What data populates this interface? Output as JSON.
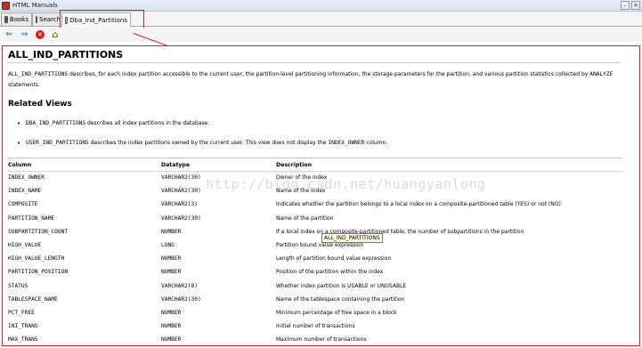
{
  "window": {
    "title": "HTML Manuals"
  },
  "tabs": [
    {
      "label": "Books"
    },
    {
      "label": "Search"
    },
    {
      "label": "Dba_Ind_Partitions"
    }
  ],
  "toolbar": {
    "back_icon": "back-arrow-icon",
    "forward_icon": "forward-arrow-icon",
    "stop_icon": "stop-icon",
    "home_icon": "home-icon"
  },
  "page": {
    "title": "ALL_IND_PARTITIONS",
    "intro": {
      "code1": "ALL_IND_PARTITIONS",
      "text": " describes, for each index partition accessible to the current user, the partition-level partitioning information, the storage parameters for the partition, and various partition statistics collected by ",
      "code2": "ANALYZE",
      "text2": " statements."
    },
    "related_heading": "Related Views",
    "related": [
      {
        "code": "DBA_IND_PARTITIONS",
        "text": " describes all index partitions in the database.",
        "code_b": "",
        "text_b": ""
      },
      {
        "code": "USER_IND_PARTITIONS",
        "text": " describes the index partitions owned by the current user. This view does not display the ",
        "code_b": "INDEX_OWNER",
        "text_b": " column."
      }
    ],
    "columns_header": {
      "col1": "Column",
      "col2": "Datatype",
      "col3": "Description"
    },
    "rows": [
      {
        "column": "INDEX_OWNER",
        "datatype": "VARCHAR2(30)",
        "desc": "Owner of the index"
      },
      {
        "column": "INDEX_NAME",
        "datatype": "VARCHAR2(30)",
        "desc": "Name of the index"
      },
      {
        "column": "COMPOSITE",
        "datatype": "VARCHAR2(3)",
        "desc": "Indicates whether the partition belongs to a local index on a composite-partitioned table (YES) or not (NO)"
      },
      {
        "column": "PARTITION_NAME",
        "datatype": "VARCHAR2(30)",
        "desc": "Name of the partition"
      },
      {
        "column": "SUBPARTITION_COUNT",
        "datatype": "NUMBER",
        "desc": "If a local index on a composite-partitioned table, the number of subpartitions in the partition"
      },
      {
        "column": "HIGH_VALUE",
        "datatype": "LONG",
        "desc": "Partition bound value expression"
      },
      {
        "column": "HIGH_VALUE_LENGTH",
        "datatype": "NUMBER",
        "desc": "Length of partition bound value expression"
      },
      {
        "column": "PARTITION_POSITION",
        "datatype": "NUMBER",
        "desc": "Position of the partition within the index"
      },
      {
        "column": "STATUS",
        "datatype": "VARCHAR2(8)",
        "desc": "Whether index partition is USABLE or UNUSABLE"
      },
      {
        "column": "TABLESPACE_NAME",
        "datatype": "VARCHAR2(30)",
        "desc": "Name of the tablespace containing the partition"
      },
      {
        "column": "PCT_FREE",
        "datatype": "NUMBER",
        "desc": "Minimum percentage of free space in a block"
      },
      {
        "column": "INI_TRANS",
        "datatype": "NUMBER",
        "desc": "Initial number of transactions"
      },
      {
        "column": "MAX_TRANS",
        "datatype": "NUMBER",
        "desc": "Maximum number of transactions"
      }
    ],
    "tooltip": "ALL_IND_PARTITIONS",
    "watermark": "http://blog.csdn.net/huangyanlong"
  },
  "colors": {
    "annotation_red": "#d81f26",
    "tooltip_bg": "#ffffe1"
  }
}
